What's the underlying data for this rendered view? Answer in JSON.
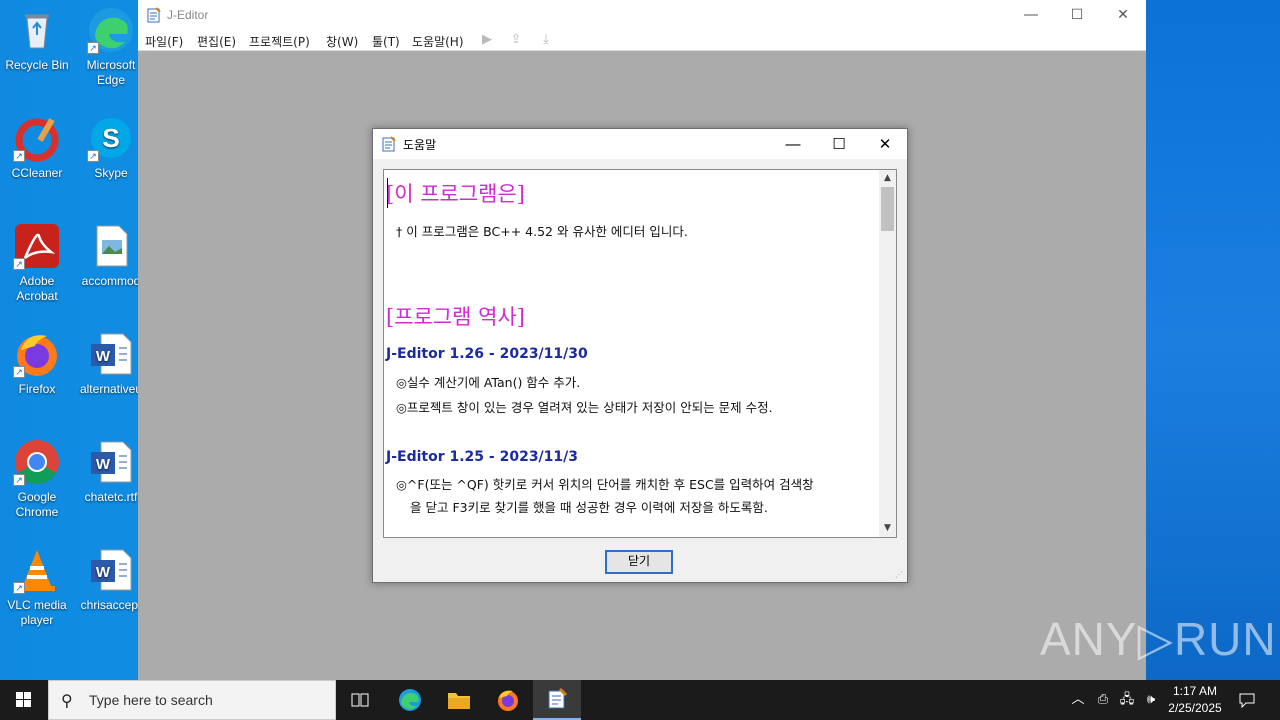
{
  "desktop": {
    "icons": [
      {
        "label": "Recycle Bin"
      },
      {
        "label": "Microsoft Edge"
      },
      {
        "label": "CCleaner"
      },
      {
        "label": "Skype"
      },
      {
        "label": "Adobe Acrobat"
      },
      {
        "label": "accommod"
      },
      {
        "label": "Firefox"
      },
      {
        "label": "alternativeu"
      },
      {
        "label": "Google Chrome"
      },
      {
        "label": "chatetc.rtf"
      },
      {
        "label": "VLC media player"
      },
      {
        "label": "chrisaccep."
      }
    ]
  },
  "editor": {
    "title": "J-Editor",
    "menu": [
      "파일(F)",
      "편집(E)",
      "프로젝트(P)",
      "창(W)",
      "툴(T)",
      "도움말(H)"
    ],
    "toolbar_icons": [
      "run-icon",
      "build-icon",
      "download-icon"
    ]
  },
  "help_dialog": {
    "title": "도움말",
    "section1_heading": "[이 프로그램은]",
    "section1_line": "† 이 프로그램은 BC++ 4.52 와 유사한 에디터 입니다.",
    "section2_heading": "[프로그램 역사]",
    "v126_heading": "J-Editor 1.26 - 2023/11/30",
    "v126_line1": "◎실수 계산기에 ATan() 함수 추가.",
    "v126_line2": "◎프로젝트 창이 있는 경우 열려져 있는 상태가 저장이 안되는 문제 수정.",
    "v125_heading": "J-Editor 1.25 - 2023/11/3",
    "v125_line1": "◎^F(또는 ^QF) 핫키로 커서 위치의 단어를 캐치한 후 ESC를 입력하여 검색창",
    "v125_line2": "을 닫고 F3키로 찾기를 했을 때 성공한 경우 이력에 저장을 하도록함.",
    "close_label": "닫기"
  },
  "watermark": "ANY▷RUN",
  "taskbar": {
    "search_placeholder": "Type here to search",
    "time": "1:17 AM",
    "date": "2/25/2025"
  }
}
